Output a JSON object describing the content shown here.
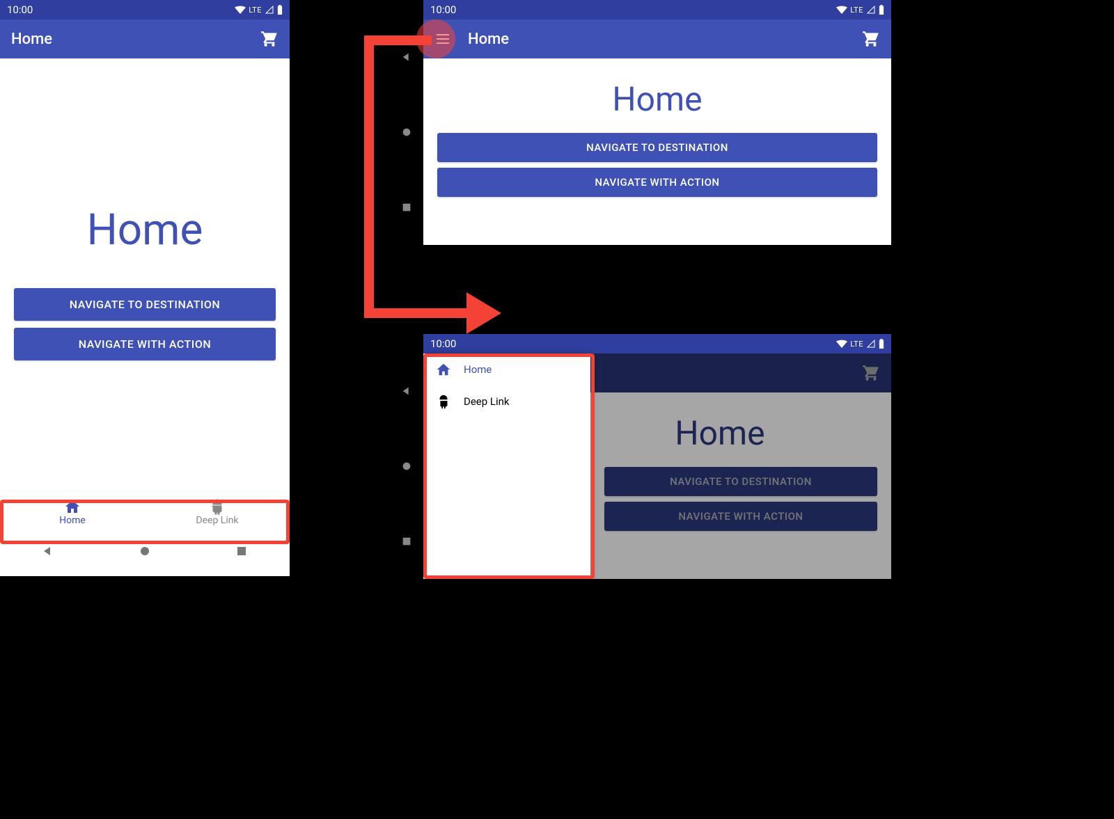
{
  "status": {
    "time": "10:00",
    "network": "LTE"
  },
  "appbar": {
    "title": "Home"
  },
  "content": {
    "heading": "Home",
    "btn_nav_to_dest": "NAVIGATE TO DESTINATION",
    "btn_nav_with_action": "NAVIGATE WITH ACTION"
  },
  "bottomnav": {
    "home": "Home",
    "deeplink": "Deep Link"
  },
  "drawer": {
    "home": "Home",
    "deeplink": "Deep Link"
  }
}
